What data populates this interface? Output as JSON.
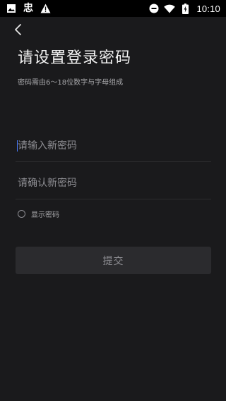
{
  "status_bar": {
    "carrier_glyph": "忠",
    "time": "10:10"
  },
  "page": {
    "title": "请设置登录密码",
    "subtitle": "密码需由6～18位数字与字母组成"
  },
  "form": {
    "new_password": {
      "value": "",
      "placeholder": "请输入新密码"
    },
    "confirm_password": {
      "value": "",
      "placeholder": "请确认新密码"
    },
    "show_password": {
      "label": "显示密码",
      "checked": false
    },
    "submit_label": "提交"
  },
  "colors": {
    "background": "#1a1a1c",
    "status_bar": "#000000",
    "accent_caret": "#4a7cff",
    "button_bg": "#2b2b2e"
  }
}
